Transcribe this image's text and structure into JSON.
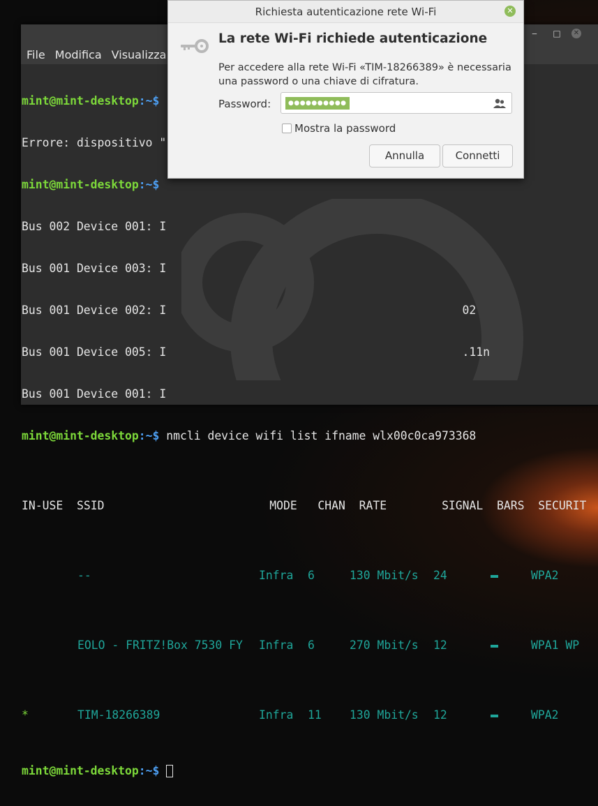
{
  "terminal": {
    "menu": [
      "File",
      "Modifica",
      "Visualizza"
    ],
    "lines": [
      {
        "kind": "prompt",
        "user": "mint@mint-desktop",
        "path": ":~$",
        "cmd": ""
      },
      {
        "kind": "plain",
        "text": "Errore: dispositivo \""
      },
      {
        "kind": "prompt",
        "user": "mint@mint-desktop",
        "path": ":~$",
        "cmd": ""
      },
      {
        "kind": "plain",
        "text": "Bus 002 Device 001: I"
      },
      {
        "kind": "plain",
        "text": "Bus 001 Device 003: I"
      },
      {
        "kind": "plain",
        "text": "Bus 001 Device 002: I                                           02"
      },
      {
        "kind": "plain",
        "text": "Bus 001 Device 005: I                                           .11n"
      },
      {
        "kind": "plain",
        "text": "Bus 001 Device 001: I"
      },
      {
        "kind": "prompt",
        "user": "mint@mint-desktop",
        "path": ":~$",
        "cmd": " nmcli device wifi list ifname wlx00c0ca973368"
      }
    ],
    "wifi_table": {
      "headers": [
        "IN-USE",
        "SSID",
        "MODE",
        "CHAN",
        "RATE",
        "SIGNAL",
        "BARS",
        "SECURIT"
      ],
      "rows": [
        {
          "in_use": "",
          "ssid": "--",
          "mode": "Infra",
          "chan": "6",
          "rate": "130 Mbit/s",
          "signal": "24",
          "security": "WPA2"
        },
        {
          "in_use": "",
          "ssid": "EOLO - FRITZ!Box 7530 FY",
          "mode": "Infra",
          "chan": "6",
          "rate": "270 Mbit/s",
          "signal": "12",
          "security": "WPA1 WP"
        },
        {
          "in_use": "*",
          "ssid": "TIM-18266389",
          "mode": "Infra",
          "chan": "11",
          "rate": "130 Mbit/s",
          "signal": "12",
          "security": "WPA2"
        }
      ]
    },
    "final_prompt": {
      "user": "mint@mint-desktop",
      "path": ":~$"
    }
  },
  "dialog": {
    "title": "Richiesta autenticazione rete Wi-Fi",
    "heading": "La rete Wi-Fi richiede autenticazione",
    "message": "Per accedere alla rete Wi-Fi «TIM-18266389» è necessaria una password o una chiave di cifratura.",
    "password_label": "Password:",
    "password_value": "●●●●●●●●●●",
    "show_password_label": "Mostra la password",
    "cancel_label": "Annulla",
    "connect_label": "Connetti"
  },
  "colors": {
    "prompt_user": "#7dd93a",
    "prompt_path": "#4d9ff2",
    "table_teal": "#1fa69a",
    "password_highlight": "#8fbc5a"
  }
}
